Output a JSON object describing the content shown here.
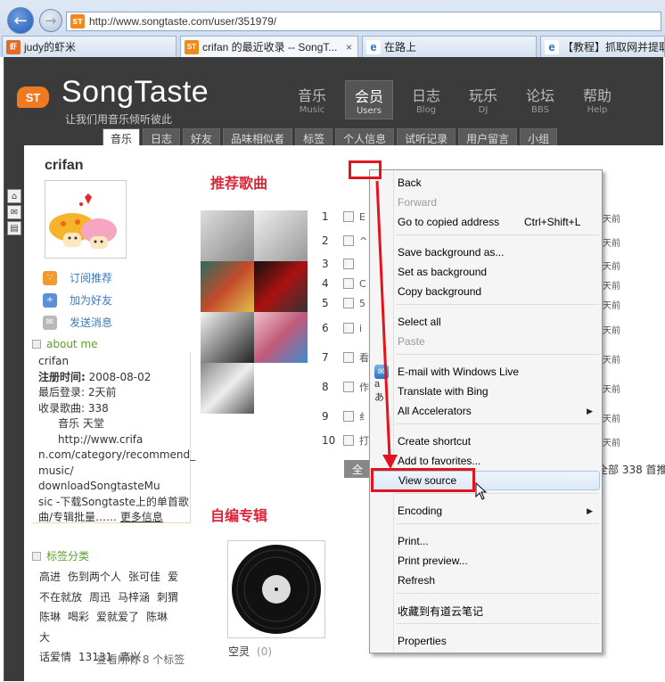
{
  "browser": {
    "back_icon": "arrow-left",
    "forward_icon": "arrow-right",
    "address": "http://www.songtaste.com/user/351979/",
    "address_favicon": "ST",
    "tabs": [
      {
        "label": "judy的虾米",
        "icon_text": "虾",
        "active": false
      },
      {
        "label": "crifan 的最近收录 -- SongT...",
        "icon_text": "ST",
        "active": true
      },
      {
        "label": "在路上",
        "icon_text": "e",
        "active": false
      },
      {
        "label": "【教程】抓取网并提取",
        "icon_text": "e",
        "active": false
      }
    ],
    "tab_close": "×"
  },
  "site": {
    "logo_badge": "ST",
    "logo_text": "SongTaste",
    "tagline": "让我们用音乐倾听彼此",
    "topnav": [
      {
        "cn": "音乐",
        "en": "Music"
      },
      {
        "cn": "会员",
        "en": "Users"
      },
      {
        "cn": "日志",
        "en": "Blog"
      },
      {
        "cn": "玩乐",
        "en": "DJ"
      },
      {
        "cn": "论坛",
        "en": "BBS"
      },
      {
        "cn": "帮助",
        "en": "Help"
      }
    ],
    "subnav": [
      "音乐",
      "日志",
      "好友",
      "品味相似者",
      "标签",
      "个人信息",
      "试听记录",
      "用户留言",
      "小组"
    ]
  },
  "profile": {
    "username": "crifan",
    "links": [
      "订阅推荐",
      "加为好友",
      "发送消息"
    ],
    "about_title": "about me",
    "about_name": "crifan",
    "reg_label": "注册时间:",
    "reg_value": "2008-08-02",
    "last_login": "最后登录: 2天前",
    "song_count": "收录歌曲: 338",
    "bio_lines": [
      "音乐  天堂  http://www.crifa",
      "n.com/category/recommend_",
      "music/ downloadSongtasteMu",
      "sic -下载Songtaste上的单首歌"
    ],
    "bio_end": "曲/专辑批量……",
    "more": "更多信息",
    "tags_title": "标签分类",
    "tags": [
      "高进",
      "伤到两个人",
      "张可佳",
      "爱",
      "不在就放",
      "周迅",
      "马梓涵",
      "刺猬",
      "陈琳",
      "喝彩",
      "爱就爱了",
      "陈琳",
      "大",
      "话爱情",
      "13131",
      "高兴"
    ],
    "tags_footer": "查看所有  8 个标签"
  },
  "recommend": {
    "title": "推荐歌曲",
    "rows": [
      {
        "num": "1",
        "t": "E"
      },
      {
        "num": "2",
        "t": "^"
      },
      {
        "num": "3",
        "t": ""
      },
      {
        "num": "4",
        "t": "C"
      },
      {
        "num": "5",
        "t": "5"
      },
      {
        "num": "6",
        "t": "i"
      },
      {
        "num": "7",
        "t": "看"
      },
      {
        "num": "8",
        "t": "作"
      },
      {
        "num": "9",
        "t": "纟"
      },
      {
        "num": "10",
        "t": "打"
      }
    ],
    "ago_label": "天前",
    "all_button": "全",
    "all_footer": "全部  338 首推"
  },
  "albums": {
    "title": "自编专辑",
    "items": [
      {
        "name": "空灵",
        "count": "(0)"
      }
    ]
  },
  "context_menu": {
    "items": [
      {
        "label": "Back",
        "enabled": true
      },
      {
        "label": "Forward",
        "enabled": false
      },
      {
        "label": "Go to copied address",
        "shortcut": "Ctrl+Shift+L",
        "enabled": true
      },
      {
        "label": "Save background as...",
        "enabled": true
      },
      {
        "label": "Set as background",
        "enabled": true
      },
      {
        "label": "Copy background",
        "enabled": true
      },
      {
        "label": "Select all",
        "enabled": true
      },
      {
        "label": "Paste",
        "enabled": false
      },
      {
        "label": "E-mail with Windows Live",
        "enabled": true,
        "icon": "windows-live-icon"
      },
      {
        "label": "Translate with Bing",
        "enabled": true,
        "icon": "translate-icon"
      },
      {
        "label": "All Accelerators",
        "enabled": true,
        "submenu": true
      },
      {
        "label": "Create shortcut",
        "enabled": true
      },
      {
        "label": "Add to favorites...",
        "enabled": true
      },
      {
        "label": "View source",
        "enabled": true,
        "highlighted": true
      },
      {
        "label": "Encoding",
        "enabled": true,
        "submenu": true
      },
      {
        "label": "Print...",
        "enabled": true
      },
      {
        "label": "Print preview...",
        "enabled": true
      },
      {
        "label": "Refresh",
        "enabled": true
      },
      {
        "label": "收藏到有道云笔记",
        "enabled": true
      },
      {
        "label": "Properties",
        "enabled": true
      }
    ]
  },
  "colors": {
    "accent_red": "#e4141e",
    "section_title": "#d9263a",
    "link_blue": "#3a7ac0",
    "tag_green": "#5aa02c",
    "page_bg": "#3b3b3b"
  }
}
